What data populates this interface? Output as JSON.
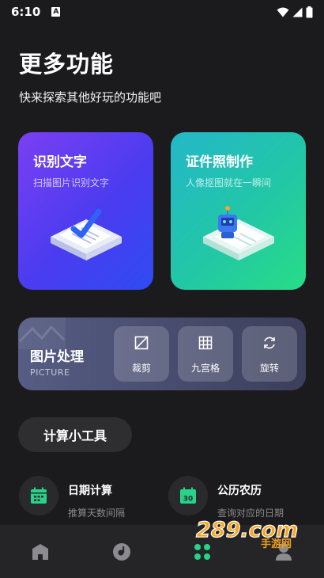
{
  "status": {
    "time": "6:10",
    "notif_letter": "A"
  },
  "header": {
    "title": "更多功能",
    "subtitle": "快来探索其他好玩的功能吧"
  },
  "cards": {
    "ocr": {
      "title": "识别文字",
      "subtitle": "扫描图片识别文字"
    },
    "id_photo": {
      "title": "证件照制作",
      "subtitle": "人像抠图就在一瞬间"
    }
  },
  "image_processing": {
    "title": "图片处理",
    "subtitle": "PICTURE",
    "tools": [
      {
        "label": "裁剪",
        "icon": "crop-icon"
      },
      {
        "label": "九宫格",
        "icon": "grid-icon"
      },
      {
        "label": "旋转",
        "icon": "rotate-icon"
      }
    ]
  },
  "calculator": {
    "label": "计算小工具"
  },
  "utilities": [
    {
      "title": "日期计算",
      "subtitle": "推算天数间隔",
      "icon": "calendar-grid-icon"
    },
    {
      "title": "公历农历",
      "subtitle": "查询对应的日期",
      "icon": "calendar-30-icon",
      "icon_text": "30"
    }
  ],
  "tabbar": {
    "tabs": [
      {
        "name": "home",
        "icon": "home-icon",
        "active": false
      },
      {
        "name": "discover",
        "icon": "disc-icon",
        "active": false
      },
      {
        "name": "more",
        "icon": "apps-grid-icon",
        "active": true
      },
      {
        "name": "profile",
        "icon": "user-icon",
        "active": false
      }
    ]
  },
  "watermark": {
    "text": "289.com",
    "subtext": "手游网"
  },
  "colors": {
    "background": "#1b1b1d",
    "accent_green": "#27d38a",
    "ocr_gradient_start": "#7b3ff2",
    "ocr_gradient_end": "#2f4bf3",
    "id_gradient_start": "#24b7c9",
    "id_gradient_end": "#27dd86"
  }
}
